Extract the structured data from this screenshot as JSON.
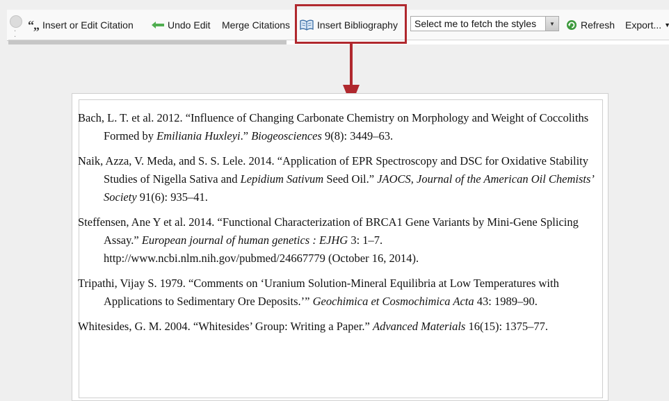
{
  "toolbar": {
    "insert_citation_label": "Insert or Edit Citation",
    "undo_label": "Undo Edit",
    "merge_label": "Merge Citations",
    "insert_bibliography_label": "Insert Bibliography",
    "style_select_value": "Select me to fetch the styles",
    "refresh_label": "Refresh",
    "export_label": "Export...",
    "icons": {
      "citation": "quote-icon",
      "undo": "arrow-left-icon",
      "bibliography": "book-icon",
      "refresh": "refresh-icon",
      "export": "chevron-down-icon"
    }
  },
  "colors": {
    "highlight": "#b0282e",
    "undo_icon": "#4fae4f",
    "refresh_icon": "#3d9a3d",
    "book_icon": "#3a6ea5"
  },
  "bibliography": {
    "entries": [
      {
        "before": "Bach, L. T. et al. 2012. “Influence of Changing Carbonate Chemistry on Morphology and Weight of Coccoliths Formed by ",
        "italic1": "Emiliania Huxleyi",
        "middle": ".” ",
        "italic2": "Biogeosciences",
        "after": " 9(8): 3449–63."
      },
      {
        "before": "Naik, Azza, V. Meda, and S. S. Lele. 2014. “Application of EPR Spectroscopy and DSC for Oxidative Stability Studies of Nigella Sativa and ",
        "italic1": "Lepidium Sativum",
        "middle": " Seed Oil.” ",
        "italic2": "JAOCS, Journal of the American Oil Chemists’ Society",
        "after": " 91(6): 935–41."
      },
      {
        "before": "Steffensen, Ane Y et al. 2014. “Functional Characterization of BRCA1 Gene Variants by Mini-Gene Splicing Assay.” ",
        "italic1": "European journal of human genetics : EJHG",
        "middle": " 3: 1–7. http://www.ncbi.nlm.nih.gov/pubmed/24667779 (October 16, 2014).",
        "italic2": "",
        "after": ""
      },
      {
        "before": "Tripathi, Vijay S. 1979. “Comments on ‘Uranium Solution-Mineral Equilibria at Low Temperatures with Applications to Sedimentary Ore Deposits.’” ",
        "italic1": "Geochimica et Cosmochimica Acta",
        "middle": " 43: 1989–90.",
        "italic2": "",
        "after": ""
      },
      {
        "before": "Whitesides, G. M. 2004. “Whitesides’ Group: Writing a Paper.” ",
        "italic1": "Advanced Materials",
        "middle": " 16(15): 1375–77.",
        "italic2": "",
        "after": ""
      }
    ]
  }
}
